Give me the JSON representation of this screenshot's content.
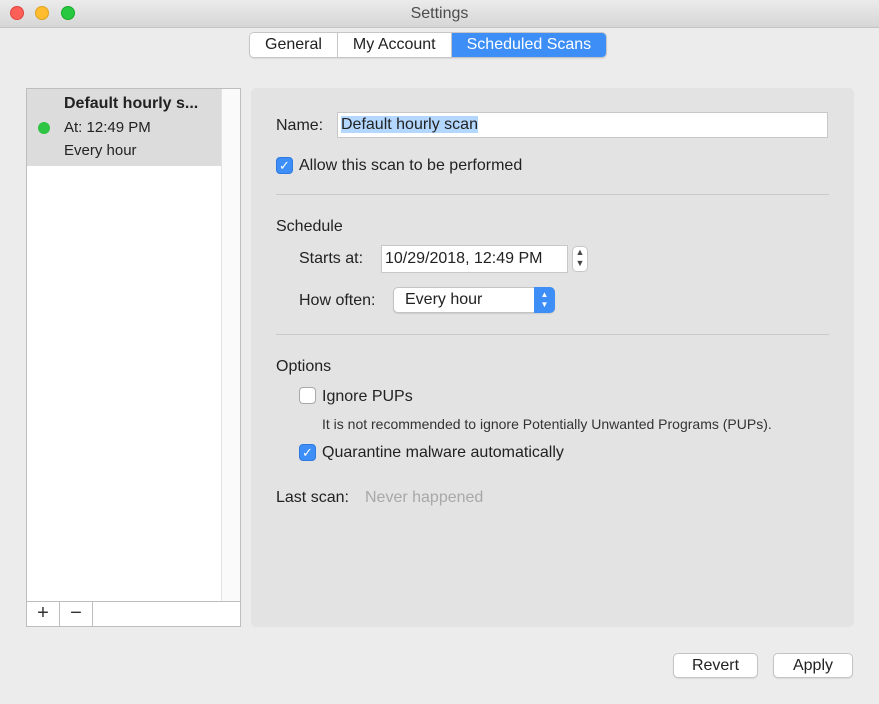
{
  "window": {
    "title": "Settings"
  },
  "tabs": [
    {
      "label": "General"
    },
    {
      "label": "My Account"
    },
    {
      "label": "Scheduled Scans",
      "active": true
    }
  ],
  "scan_list": {
    "items": [
      {
        "title": "Default hourly s...",
        "time": "At: 12:49 PM",
        "frequency": "Every hour",
        "status_color": "#2ec444"
      }
    ],
    "add_label": "+",
    "remove_label": "−"
  },
  "form": {
    "name_label": "Name:",
    "name_value": "Default hourly scan",
    "allow_label": "Allow this scan to be performed",
    "allow_checked": true,
    "schedule_heading": "Schedule",
    "starts_at_label": "Starts at:",
    "starts_at_value": "10/29/2018, 12:49 PM",
    "how_often_label": "How often:",
    "how_often_value": "Every hour",
    "options_heading": "Options",
    "ignore_pups_label": "Ignore PUPs",
    "ignore_pups_checked": false,
    "ignore_pups_note": "It is not recommended to ignore Potentially Unwanted Programs (PUPs).",
    "quarantine_label": "Quarantine malware automatically",
    "quarantine_checked": true,
    "last_scan_label": "Last scan:",
    "last_scan_value": "Never happened"
  },
  "footer": {
    "revert_label": "Revert",
    "apply_label": "Apply"
  },
  "colors": {
    "accent": "#3d8ff7",
    "selection": "#b3d7ff",
    "status_green": "#2ec444"
  }
}
